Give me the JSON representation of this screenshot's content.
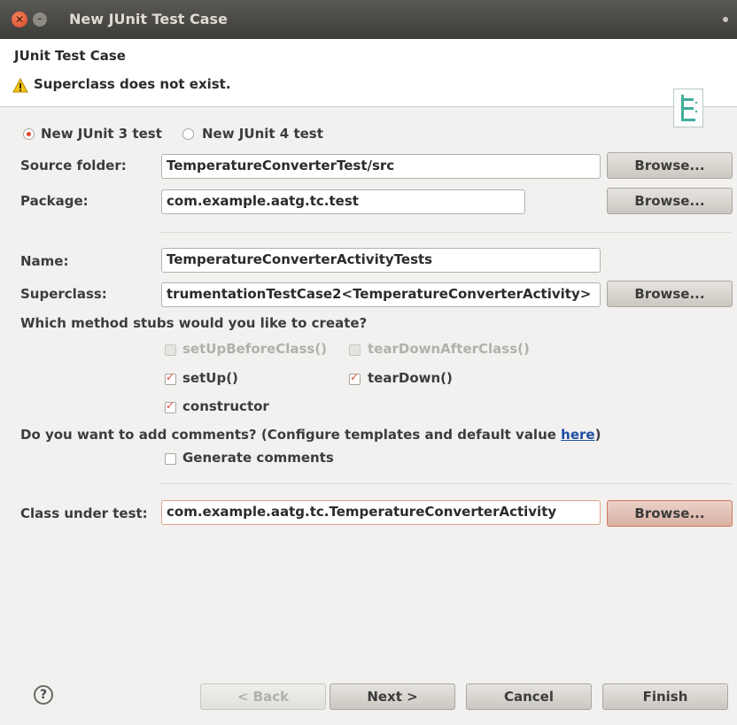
{
  "titlebar": {
    "title": "New JUnit Test Case",
    "close_glyph": "✕",
    "min_glyph": "–"
  },
  "header": {
    "title": "JUnit Test Case",
    "message": "Superclass does not exist."
  },
  "version": {
    "junit3_label": "New JUnit 3 test",
    "junit4_label": "New JUnit 4 test",
    "selected": "junit3"
  },
  "source_folder": {
    "label": "Source folder:",
    "value": "TemperatureConverterTest/src",
    "browse": "Browse..."
  },
  "package": {
    "label": "Package:",
    "value": "com.example.aatg.tc.test",
    "browse": "Browse..."
  },
  "name": {
    "label": "Name:",
    "value": "TemperatureConverterActivityTests"
  },
  "superclass": {
    "label": "Superclass:",
    "value": "trumentationTestCase2<TemperatureConverterActivity>",
    "browse": "Browse..."
  },
  "stubs": {
    "question": "Which method stubs would you like to create?",
    "setUpBeforeClass": "setUpBeforeClass()",
    "tearDownAfterClass": "tearDownAfterClass()",
    "setUp": "setUp()",
    "tearDown": "tearDown()",
    "constructor": "constructor"
  },
  "comments": {
    "question_prefix": "Do you want to add comments? (Configure templates and default value ",
    "link": "here",
    "question_suffix": ")",
    "generate_label": "Generate comments"
  },
  "class_under_test": {
    "label": "Class under test:",
    "value": "com.example.aatg.tc.TemperatureConverterActivity",
    "browse": "Browse..."
  },
  "footer": {
    "help_glyph": "?",
    "back": "< Back",
    "next": "Next >",
    "cancel": "Cancel",
    "finish": "Finish"
  },
  "colors": {
    "accent": "#df4a2a",
    "link": "#1e4fa3",
    "titlebar": "#3d3c38"
  }
}
